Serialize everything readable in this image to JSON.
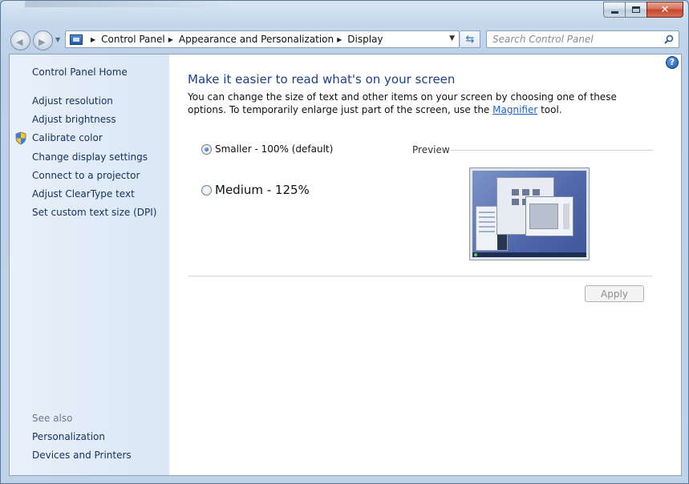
{
  "window": {
    "minimize_label": "",
    "maximize_label": "",
    "close_label": "✕"
  },
  "navigation": {
    "back_icon": "back-arrow-icon",
    "forward_icon": "forward-arrow-icon"
  },
  "address_bar": {
    "crumbs": [
      "Control Panel",
      "Appearance and Personalization",
      "Display"
    ],
    "separator": "▶",
    "dropdown_glyph": "▼"
  },
  "search": {
    "placeholder": "Search Control Panel"
  },
  "sidebar": {
    "home": "Control Panel Home",
    "items": [
      "Adjust resolution",
      "Adjust brightness",
      "Calibrate color",
      "Change display settings",
      "Connect to a projector",
      "Adjust ClearType text",
      "Set custom text size (DPI)"
    ],
    "see_also_label": "See also",
    "see_also_items": [
      "Personalization",
      "Devices and Printers"
    ]
  },
  "main": {
    "help_label": "?",
    "title": "Make it easier to read what's on your screen",
    "description_before": "You can change the size of text and other items on your screen by choosing one of these options. To temporarily enlarge just part of the screen, use the ",
    "description_link": "Magnifier",
    "description_after": " tool.",
    "options": [
      {
        "label": "Smaller - 100% (default)",
        "checked": true
      },
      {
        "label": "Medium - 125%",
        "checked": false
      }
    ],
    "preview_label": "Preview",
    "apply_label": "Apply"
  },
  "colors": {
    "title_blue": "#1e3f8c",
    "link_blue": "#1f61c6",
    "sidebar_text": "#15315d",
    "close_red": "#c4452c"
  }
}
